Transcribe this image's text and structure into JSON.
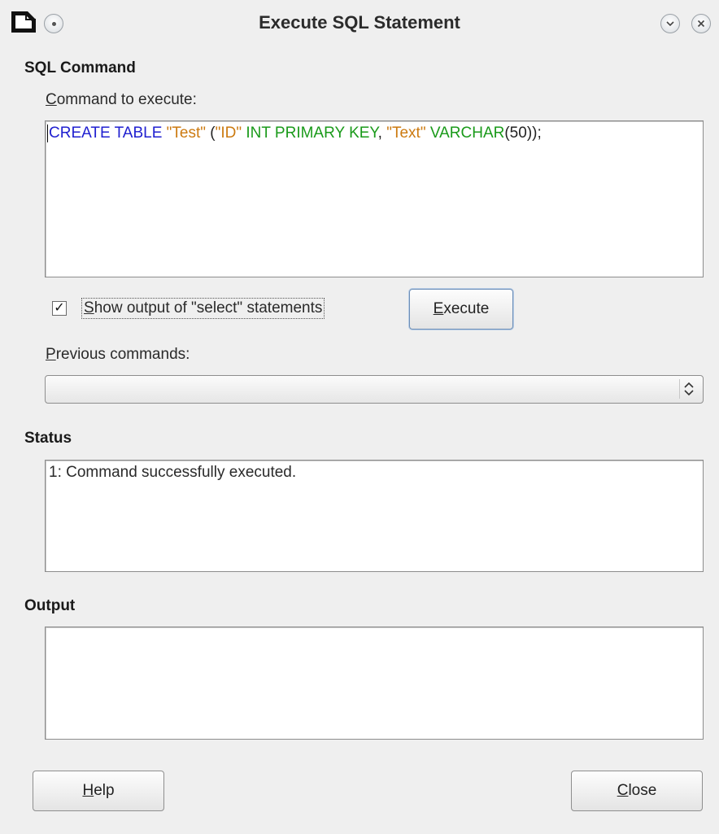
{
  "window": {
    "title": "Execute SQL Statement"
  },
  "sql_command": {
    "heading": "SQL Command",
    "command_label_key": "C",
    "command_label_rest": "ommand to execute:",
    "command_tokens": [
      {
        "text": "CREATE TABLE ",
        "type": "kw"
      },
      {
        "text": "\"Test\"",
        "type": "str"
      },
      {
        "text": " (",
        "type": "plain"
      },
      {
        "text": "\"ID\"",
        "type": "str"
      },
      {
        "text": " INT PRIMARY KEY",
        "type": "ident"
      },
      {
        "text": ", ",
        "type": "plain"
      },
      {
        "text": "\"Text\"",
        "type": "str"
      },
      {
        "text": " VARCHAR",
        "type": "ident"
      },
      {
        "text": "(50));",
        "type": "plain"
      }
    ],
    "show_output_checked": true,
    "show_output_label_key": "S",
    "show_output_label_rest": "how output of \"select\" statements",
    "execute_label_key": "E",
    "execute_label_rest": "xecute",
    "previous_label_key": "P",
    "previous_label_rest": "revious commands:",
    "previous_selected": ""
  },
  "status": {
    "heading": "Status",
    "text": "1: Command successfully executed."
  },
  "output": {
    "heading": "Output",
    "text": ""
  },
  "footer": {
    "help_key": "H",
    "help_rest": "elp",
    "close_key": "C",
    "close_rest": "lose"
  },
  "icons": {
    "app": "document-icon",
    "menu": "window-menu-icon",
    "minimize": "chevron-down-icon",
    "close": "close-icon",
    "combo": "up-down-arrows-icon",
    "check": "checkmark-icon"
  }
}
